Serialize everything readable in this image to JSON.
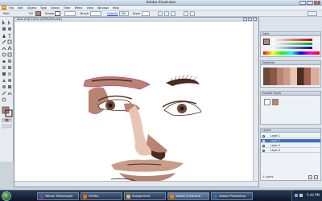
{
  "app": {
    "title": "Adobe Illustrator",
    "logo": "Ai"
  },
  "window_controls": [
    "−",
    "□",
    "×"
  ],
  "menu": [
    "File",
    "Edit",
    "Object",
    "Type",
    "Select",
    "Filter",
    "Effect",
    "View",
    "Window",
    "Help"
  ],
  "control_bar": {
    "selection": "Path",
    "fill_label": "Fill",
    "stroke_label": "Stroke",
    "brush_label": "Brush",
    "opacity_label": "Opacity",
    "opacity_value": "100",
    "style_label": "Style"
  },
  "document": {
    "tab": "face.ai @ 100% (CMYK/Preview)"
  },
  "panels": {
    "swatches": {
      "title": "Color"
    },
    "brushes": {
      "title": "Swatches"
    },
    "appearance": {
      "title": "Graphic Styles"
    },
    "layers": {
      "title": "Layers",
      "rows": [
        {
          "name": "Layer 1",
          "selected": false
        },
        {
          "name": "Layer 2",
          "selected": true
        },
        {
          "name": "Layer 3",
          "selected": false
        },
        {
          "name": "Layer 4",
          "selected": false
        }
      ],
      "count": "4 Layers"
    }
  },
  "taskbar": {
    "items": [
      {
        "label": "Yahoo! Messenger",
        "active": false,
        "icon_color": "#7b3fa0"
      },
      {
        "label": "Firefox",
        "active": false,
        "icon_color": "#e46c1a"
      },
      {
        "label": "Assignment",
        "active": false,
        "icon_color": "#d9b65a"
      },
      {
        "label": "Adobe Illustrator",
        "active": true,
        "icon_color": "#ef7d00"
      },
      {
        "label": "Adobe Photoshop",
        "active": false,
        "icon_color": "#2f6db0"
      }
    ],
    "clock": "5:42 PM"
  },
  "colors": {
    "skin_shadow": "#b88370",
    "skin_light": "#e8c5b3",
    "hair": "#4a2c20",
    "iris": "#6b4a3a",
    "lip": "#c99c8a",
    "selection_outline": "#c43a9a"
  },
  "icons": [
    "start-orb-icon",
    "selection-tool-icon",
    "pen-tool-icon",
    "type-tool-icon",
    "brush-tool-icon",
    "eye-icon"
  ]
}
